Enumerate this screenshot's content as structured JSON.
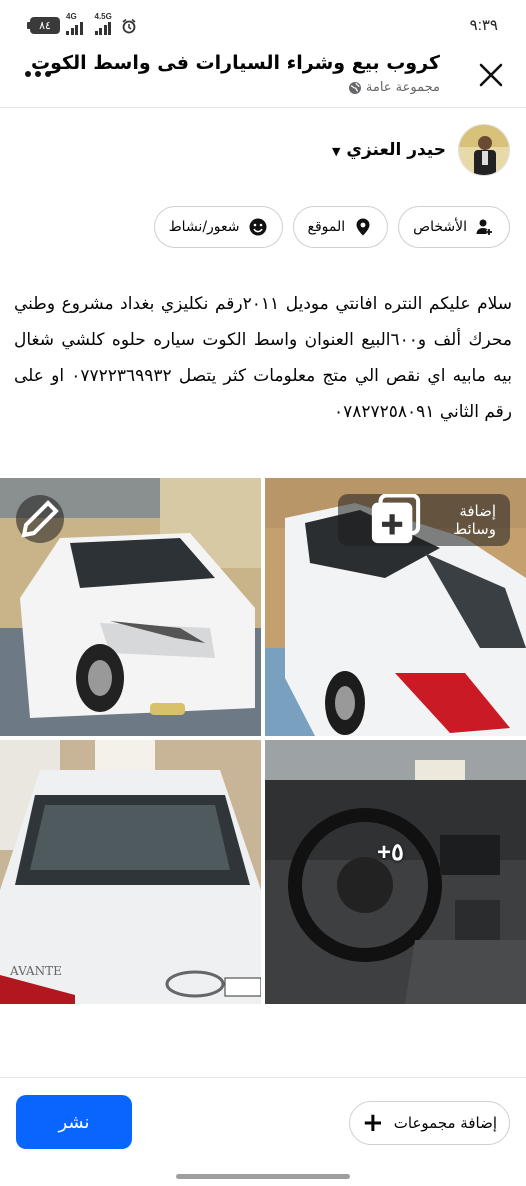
{
  "status_bar": {
    "time": "٩:٣٩",
    "battery": "٨٤",
    "signal_1": "4G",
    "signal_2": "4.5G"
  },
  "header": {
    "title": "كروب بيع وشراء السيارات فى واسط الكوت",
    "subtitle": "مجموعة عامة",
    "more_icon": "more-dots-icon",
    "close_icon": "close-icon"
  },
  "author": {
    "name": "حيدر العنزي"
  },
  "chips": [
    {
      "label": "الأشخاص",
      "icon": "people-icon"
    },
    {
      "label": "الموقع",
      "icon": "location-pin-icon"
    },
    {
      "label": "شعور/نشاط",
      "icon": "smile-icon"
    }
  ],
  "post": {
    "text": "سلام عليكم النتره افانتي موديل ٢٠١١رقم نكليزي بغداد مشروع وطني محرك ألف و٦٠٠البيع العنوان واسط الكوت سياره حلوه كلشي شغال بيه مابيه اي نقص الي متج معلومات كثر يتصل ٠٧٧٢٢٣٦٩٩٣٢ او على رقم الثاني ٠٧٨٢٧٢٥٨٠٩١"
  },
  "media": {
    "add_media_label": "إضافة وسائط",
    "more_count": "+٥",
    "photos": [
      "photo-car-front",
      "photo-car-side",
      "photo-car-rear",
      "photo-car-interior"
    ]
  },
  "bottom": {
    "publish_label": "نشر",
    "add_groups_label": "إضافة مجموعات"
  },
  "colors": {
    "accent": "#0866ff",
    "text": "#050505",
    "secondary_text": "#65676b",
    "border": "#ced0d4"
  }
}
